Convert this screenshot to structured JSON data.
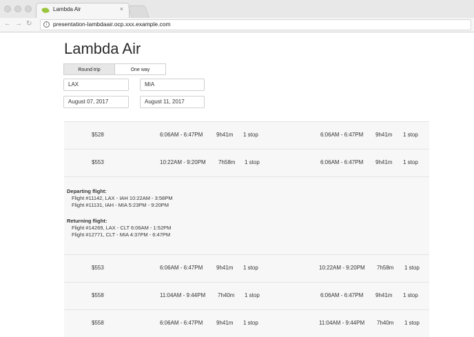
{
  "browser": {
    "tab_title": "Lambda Air",
    "tab_close": "×",
    "url": "presentation-lambdaair.ocp.xxx.example.com"
  },
  "app": {
    "title": "Lambda Air"
  },
  "search": {
    "trip_types": [
      "Round trip",
      "One way"
    ],
    "selected_trip_type": "Round trip",
    "origin": "LAX",
    "destination": "MIA",
    "depart_date": "August 07, 2017",
    "return_date": "August 11, 2017"
  },
  "results": [
    {
      "price": "$528",
      "out_times": "6:06AM - 6:47PM",
      "out_duration": "9h41m",
      "out_stops": "1 stop",
      "ret_times": "6:06AM - 6:47PM",
      "ret_duration": "9h41m",
      "ret_stops": "1 stop"
    },
    {
      "price": "$553",
      "out_times": "10:22AM - 9:20PM",
      "out_duration": "7h58m",
      "out_stops": "1 stop",
      "ret_times": "6:06AM - 6:47PM",
      "ret_duration": "9h41m",
      "ret_stops": "1 stop"
    },
    {
      "price": "$553",
      "out_times": "6:06AM - 6:47PM",
      "out_duration": "9h41m",
      "out_stops": "1 stop",
      "ret_times": "10:22AM - 9:20PM",
      "ret_duration": "7h58m",
      "ret_stops": "1 stop"
    },
    {
      "price": "$558",
      "out_times": "11:04AM - 9:44PM",
      "out_duration": "7h40m",
      "out_stops": "1 stop",
      "ret_times": "6:06AM - 6:47PM",
      "ret_duration": "9h41m",
      "ret_stops": "1 stop"
    },
    {
      "price": "$558",
      "out_times": "6:06AM - 6:47PM",
      "out_duration": "9h41m",
      "out_stops": "1 stop",
      "ret_times": "11:04AM - 9:44PM",
      "ret_duration": "7h40m",
      "ret_stops": "1 stop"
    }
  ],
  "details": {
    "departing_header": "Departing flight:",
    "departing": [
      "Flight #11142, LAX - IAH 10:22AM - 3:58PM",
      "Flight #11131, IAH - MIA 5:23PM - 9:20PM"
    ],
    "returning_header": "Returning flight:",
    "returning": [
      "Flight #14269, LAX - CLT 6:06AM - 1:52PM",
      "Flight #12771, CLT - MIA 4:37PM - 6:47PM"
    ]
  }
}
